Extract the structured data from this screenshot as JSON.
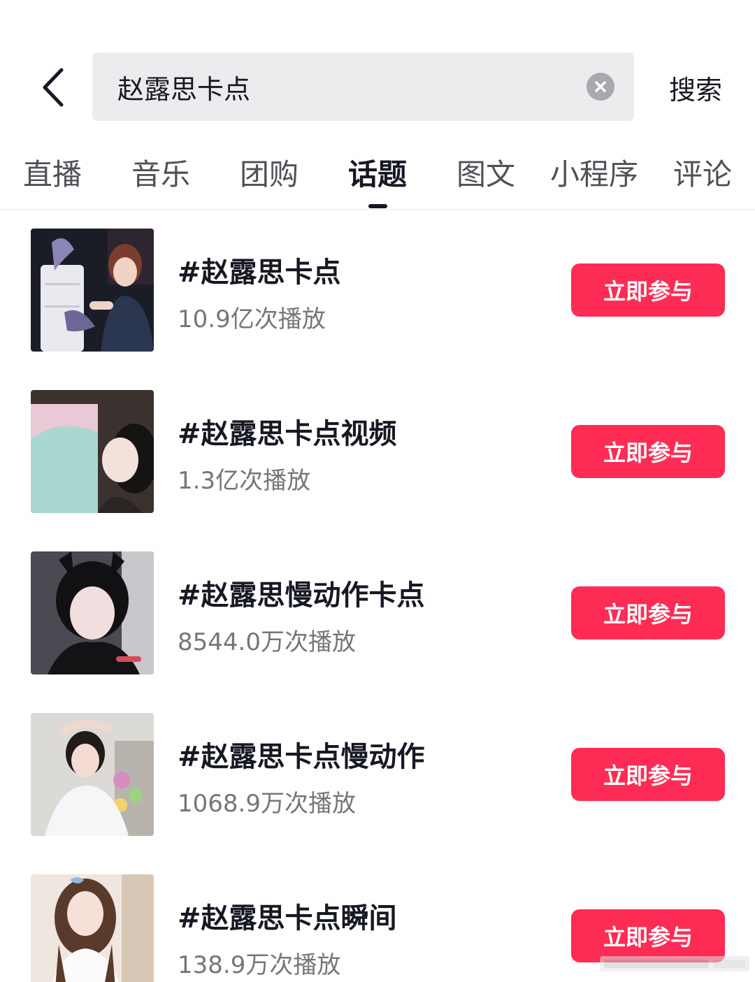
{
  "header": {
    "search_value": "赵露思卡点",
    "search_button_label": "搜索"
  },
  "tabs": [
    {
      "label": "直播",
      "active": false
    },
    {
      "label": "音乐",
      "active": false
    },
    {
      "label": "团购",
      "active": false
    },
    {
      "label": "话题",
      "active": true
    },
    {
      "label": "图文",
      "active": false
    },
    {
      "label": "小程序",
      "active": false
    },
    {
      "label": "评论",
      "active": false
    }
  ],
  "topics": [
    {
      "title": "#赵露思卡点",
      "plays": "10.9亿次播放",
      "button_label": "立即参与"
    },
    {
      "title": "#赵露思卡点视频",
      "plays": "1.3亿次播放",
      "button_label": "立即参与"
    },
    {
      "title": "#赵露思慢动作卡点",
      "plays": "8544.0万次播放",
      "button_label": "立即参与"
    },
    {
      "title": "#赵露思卡点慢动作",
      "plays": "1068.9万次播放",
      "button_label": "立即参与"
    },
    {
      "title": "#赵露思卡点瞬间",
      "plays": "138.9万次播放",
      "button_label": "立即参与"
    }
  ],
  "icons": {
    "back": "chevron-left-icon",
    "clear": "clear-circle-icon"
  },
  "colors": {
    "accent": "#fe2c55",
    "search_bg": "#ececee",
    "text_primary": "#161823",
    "text_secondary": "#75767b"
  }
}
